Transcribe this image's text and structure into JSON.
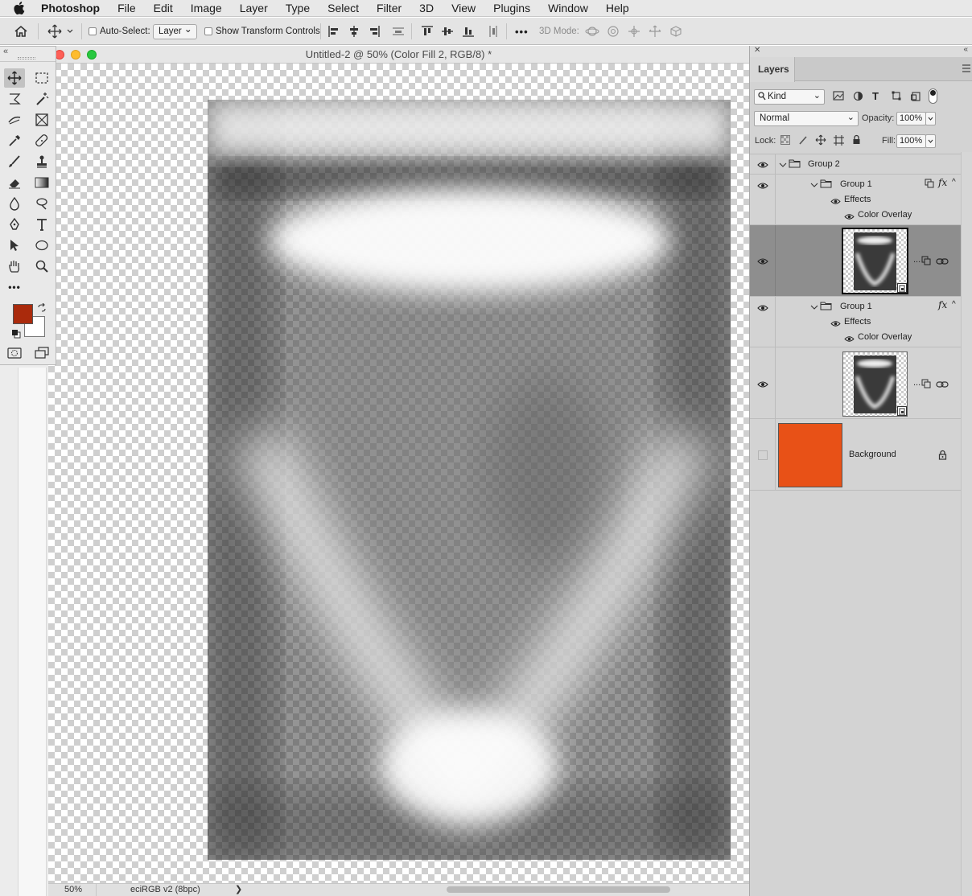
{
  "menubar": {
    "app": "Photoshop",
    "items": [
      "File",
      "Edit",
      "Image",
      "Layer",
      "Type",
      "Select",
      "Filter",
      "3D",
      "View",
      "Plugins",
      "Window",
      "Help"
    ]
  },
  "options_bar": {
    "auto_select_label": "Auto-Select:",
    "auto_select_value": "Layer",
    "show_transform_label": "Show Transform Controls",
    "more": "•••",
    "mode_3d_label": "3D Mode:"
  },
  "document": {
    "title": "Untitled-2 @ 50% (Color Fill 2, RGB/8) *",
    "zoom": "50%",
    "profile": "eciRGB v2 (8bpc)",
    "status_arrow": "❯"
  },
  "tools": {
    "more": "•••",
    "foreground_color": "#aa2a0c",
    "background_color": "#ffffff"
  },
  "layers_panel": {
    "tab": "Layers",
    "filter_kind": "Kind",
    "blend_mode": "Normal",
    "opacity_label": "Opacity:",
    "opacity_value": "100%",
    "lock_label": "Lock:",
    "fill_label": "Fill:",
    "fill_value": "100%",
    "layers": {
      "group2": "Group 2",
      "group1_a": "Group 1",
      "effects_a": "Effects",
      "overlay_a": "Color Overlay",
      "group1_b": "Group 1",
      "effects_b": "Effects",
      "overlay_b": "Color Overlay",
      "background": "Background",
      "background_color": "#e85117",
      "ellipsis": "..."
    }
  }
}
